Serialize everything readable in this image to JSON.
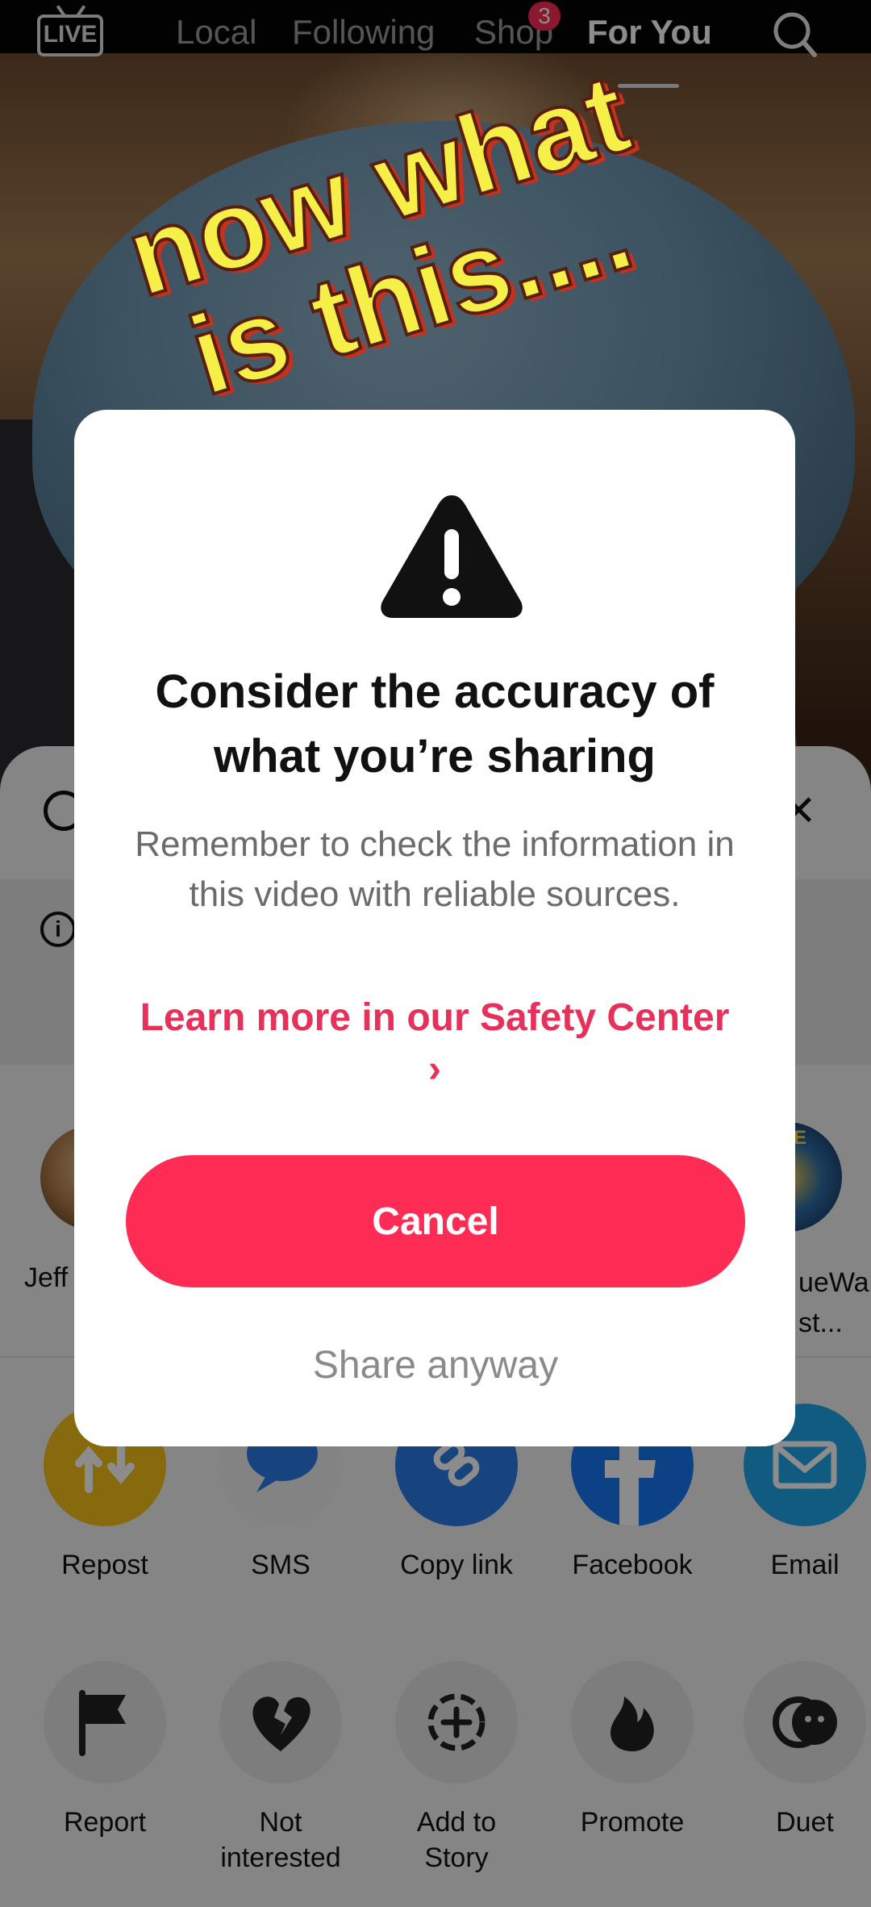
{
  "top_nav": {
    "live_label": "LIVE",
    "tabs": [
      {
        "label": "Local"
      },
      {
        "label": "Following"
      },
      {
        "label": "Shop",
        "badge": "3"
      },
      {
        "label": "For You",
        "active": true
      }
    ]
  },
  "caption": {
    "line1": "now what",
    "line2": "is this...."
  },
  "share_sheet": {
    "contacts": [
      {
        "name": "Jeff"
      },
      {
        "name_line1": "ueWa",
        "name_line2": "st..."
      },
      {
        "avatar_text": "LUE"
      }
    ],
    "share_targets": [
      {
        "label": "Repost",
        "icon": "repost-icon",
        "color": "#f6c21b"
      },
      {
        "label": "SMS",
        "icon": "sms-icon",
        "color": "#2a7de8"
      },
      {
        "label": "Copy link",
        "icon": "link-icon",
        "color": "#2a7de8"
      },
      {
        "label": "Facebook",
        "icon": "facebook-icon",
        "color": "#1877f2"
      },
      {
        "label": "Email",
        "icon": "email-icon",
        "color": "#1ea6e8"
      }
    ],
    "actions": [
      {
        "label": "Report",
        "icon": "flag-icon"
      },
      {
        "label_line1": "Not",
        "label_line2": "interested",
        "icon": "broken-heart-icon"
      },
      {
        "label_line1": "Add to",
        "label_line2": "Story",
        "icon": "add-story-icon"
      },
      {
        "label": "Promote",
        "icon": "flame-icon"
      },
      {
        "label": "Duet",
        "icon": "duet-icon"
      }
    ]
  },
  "modal": {
    "title": "Consider the accuracy of what you’re sharing",
    "body": "Remember to check the information in this video with reliable sources.",
    "link": "Learn more in our Safety Center ›",
    "cancel_label": "Cancel",
    "share_anyway_label": "Share anyway",
    "accent_color": "#fe2c55"
  }
}
